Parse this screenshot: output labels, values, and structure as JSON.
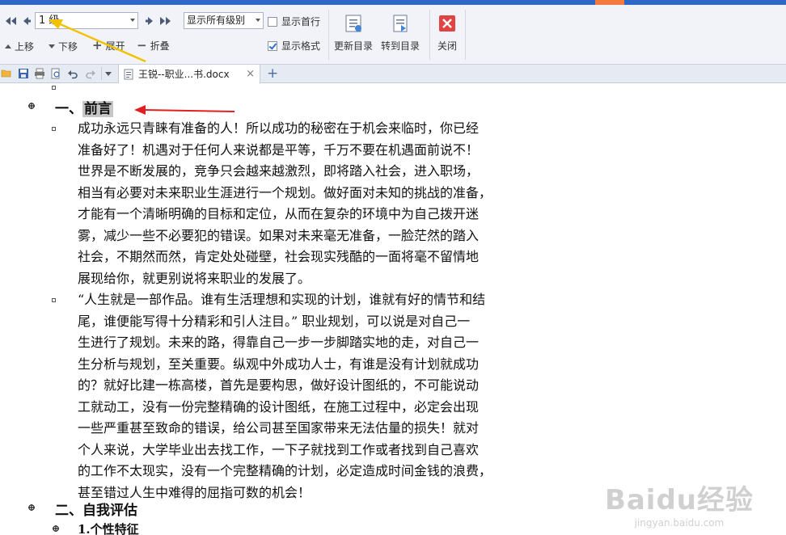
{
  "ribbon": {
    "level_value": "1 级",
    "show_level_value": "显示所有级别",
    "move_up": "上移",
    "move_down": "下移",
    "expand": "展开",
    "collapse": "折叠",
    "show_first_line": "显示首行",
    "show_format": "显示格式",
    "update_toc": "更新目录",
    "goto_toc": "转到目录",
    "close": "关闭"
  },
  "tabbar": {
    "doc_name": "王锐--职业...书.docx",
    "add": "+",
    "close": "×"
  },
  "document": {
    "heading1": {
      "prefix": "一、",
      "text": "前言"
    },
    "para1": [
      "成功永远只青睐有准备的人！所以成功的秘密在于机会来临时，你已经",
      "准备好了！机遇对于任何人来说都是平等，千万不要在机遇面前说不！",
      "世界是不断发展的，竞争只会越来越激烈，即将踏入社会，进入职场，",
      "相当有必要对未来职业生涯进行一个规划。做好面对未知的挑战的准备，",
      "才能有一个清晰明确的目标和定位，从而在复杂的环境中为自己拨开迷",
      "雾，减少一些不必要犯的错误。如果对未来毫无准备，一脸茫然的踏入",
      "社会，不期然而然，肯定处处碰壁，社会现实残酷的一面将毫不留情地",
      "展现给你，就更别说将来职业的发展了。"
    ],
    "para2": [
      "“人生就是一部作品。谁有生活理想和实现的计划，谁就有好的情节和结",
      "尾，谁便能写得十分精彩和引人注目。” 职业规划，可以说是对自己一",
      "生进行了规划。未来的路，得靠自己一步一步脚踏实地的走，对自己一",
      "生分析与规划，至关重要。纵观中外成功人士，有谁是没有计划就成功",
      "的？就好比建一栋高楼，首先是要构思，做好设计图纸的，不可能说动",
      "工就动工，没有一份完整精确的设计图纸，在施工过程中，必定会出现",
      "一些严重甚至致命的错误，给公司甚至国家带来无法估量的损失！就对",
      "个人来说，大学毕业出去找工作，一下子就找到工作或者找到自己喜欢",
      "的工作不太现实，没有一个完整精确的计划，必定造成时间金钱的浪费，",
      "甚至错过人生中难得的屈指可数的机会！"
    ],
    "heading2": "二、自我评估",
    "heading3": "1.个性特征"
  },
  "watermark": {
    "line1": "Baidu经验",
    "line2": "jingyan.baidu.com"
  },
  "colors": {
    "ribbon_bg": "#f1f3f8",
    "accent": "#2f66c8",
    "close_red": "#e04343",
    "annotation": "#e02020",
    "arrow_yellow": "#f2c200"
  }
}
